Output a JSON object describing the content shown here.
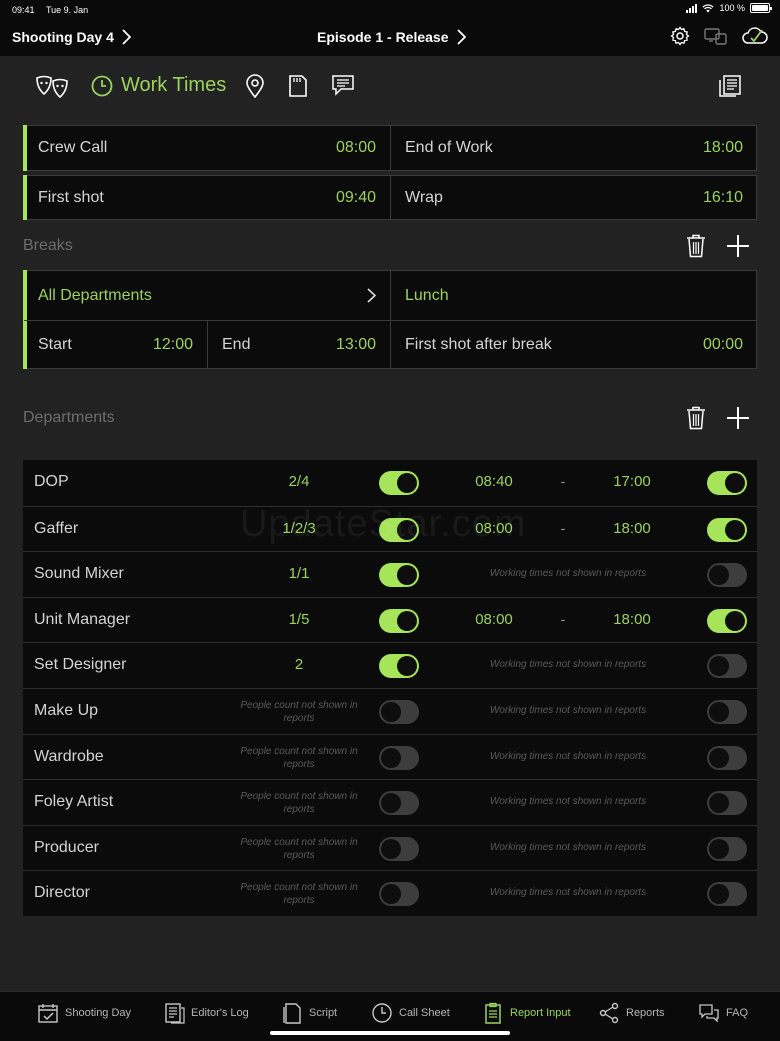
{
  "status": {
    "time": "09:41",
    "date": "Tue 9. Jan",
    "battery": "100 %"
  },
  "nav": {
    "left_title": "Shooting Day 4",
    "center_title": "Episode 1 - Release"
  },
  "tabs": {
    "active_label": "Work Times"
  },
  "times": {
    "crew_call_label": "Crew Call",
    "crew_call_value": "08:00",
    "end_of_work_label": "End of Work",
    "end_of_work_value": "18:00",
    "first_shot_label": "First shot",
    "first_shot_value": "09:40",
    "wrap_label": "Wrap",
    "wrap_value": "16:10"
  },
  "breaks": {
    "title": "Breaks",
    "department": "All Departments",
    "type": "Lunch",
    "start_label": "Start",
    "start_value": "12:00",
    "end_label": "End",
    "end_value": "13:00",
    "first_shot_after_label": "First shot after break",
    "first_shot_after_value": "00:00"
  },
  "departments": {
    "title": "Departments",
    "rows": [
      {
        "name": "DOP",
        "count": "2/4",
        "count_on": true,
        "start": "08:40",
        "dash": "-",
        "end": "17:00",
        "time_on": true
      },
      {
        "name": "Gaffer",
        "count": "1/2/3",
        "count_on": true,
        "start": "08:00",
        "dash": "-",
        "end": "18:00",
        "time_on": true
      },
      {
        "name": "Sound Mixer",
        "count": "1/1",
        "count_on": true,
        "time_note": "Working times not shown in reports",
        "time_on": false
      },
      {
        "name": "Unit Manager",
        "count": "1/5",
        "count_on": true,
        "start": "08:00",
        "dash": "-",
        "end": "18:00",
        "time_on": true
      },
      {
        "name": "Set Designer",
        "count": "2",
        "count_on": true,
        "time_note": "Working times not shown in reports",
        "time_on": false
      },
      {
        "name": "Make Up",
        "count_note": "People count not shown in reports",
        "count_on": false,
        "time_note": "Working times not shown in reports",
        "time_on": false
      },
      {
        "name": "Wardrobe",
        "count_note": "People count not shown in reports",
        "count_on": false,
        "time_note": "Working times not shown in reports",
        "time_on": false
      },
      {
        "name": "Foley Artist",
        "count_note": "People count not shown in reports",
        "count_on": false,
        "time_note": "Working times not shown in reports",
        "time_on": false
      },
      {
        "name": "Producer",
        "count_note": "People count not shown in reports",
        "count_on": false,
        "time_note": "Working times not shown in reports",
        "time_on": false
      },
      {
        "name": "Director",
        "count_note": "People count not shown in reports",
        "count_on": false,
        "time_note": "Working times not shown in reports",
        "time_on": false
      }
    ]
  },
  "watermark": "UpdateStar.com",
  "bottom_tabs": [
    {
      "label": "Shooting Day",
      "icon": "calendar-check-icon",
      "active": false
    },
    {
      "label": "Editor's Log",
      "icon": "log-icon",
      "active": false
    },
    {
      "label": "Script",
      "icon": "script-icon",
      "active": false
    },
    {
      "label": "Call Sheet",
      "icon": "clock-icon",
      "active": false
    },
    {
      "label": "Report Input",
      "icon": "clipboard-icon",
      "active": true
    },
    {
      "label": "Reports",
      "icon": "share-icon",
      "active": false
    },
    {
      "label": "FAQ",
      "icon": "chat-bubbles-icon",
      "active": false
    }
  ],
  "colors": {
    "accent": "#9bd35c",
    "toggle_on": "#a6e55a",
    "background": "#222222",
    "panel": "#0b0b0b"
  }
}
